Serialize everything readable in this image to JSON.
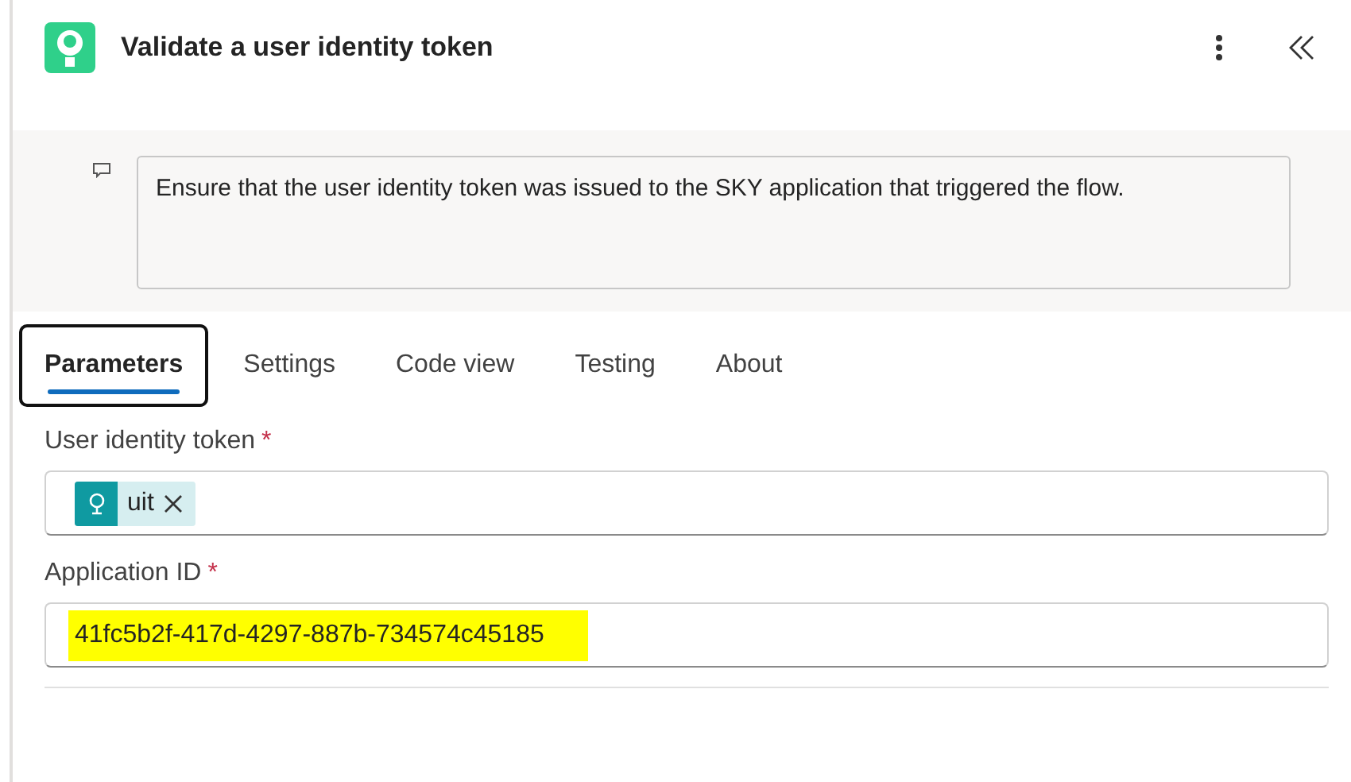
{
  "header": {
    "title": "Validate a user identity token"
  },
  "description": {
    "text": "Ensure that the user identity token was issued to the SKY application that triggered the flow."
  },
  "tabs": [
    {
      "label": "Parameters",
      "selected": true,
      "focused": true
    },
    {
      "label": "Settings",
      "selected": false,
      "focused": false
    },
    {
      "label": "Code view",
      "selected": false,
      "focused": false
    },
    {
      "label": "Testing",
      "selected": false,
      "focused": false
    },
    {
      "label": "About",
      "selected": false,
      "focused": false
    }
  ],
  "fields": [
    {
      "kind": "token",
      "label": "User identity token",
      "required_mark": "*",
      "token": "uit"
    },
    {
      "kind": "text",
      "label": "Application ID",
      "required_mark": "*",
      "value": "41fc5b2f-417d-4297-887b-734574c45185",
      "highlighted": true
    }
  ]
}
